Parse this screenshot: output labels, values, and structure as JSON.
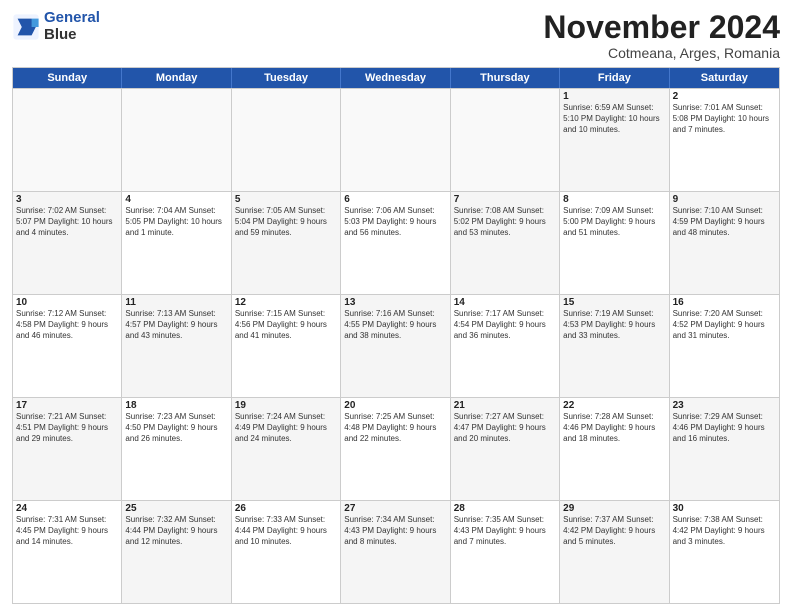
{
  "logo": {
    "line1": "General",
    "line2": "Blue"
  },
  "title": "November 2024",
  "subtitle": "Cotmeana, Arges, Romania",
  "days": [
    "Sunday",
    "Monday",
    "Tuesday",
    "Wednesday",
    "Thursday",
    "Friday",
    "Saturday"
  ],
  "rows": [
    [
      {
        "day": "",
        "text": "",
        "empty": true
      },
      {
        "day": "",
        "text": "",
        "empty": true
      },
      {
        "day": "",
        "text": "",
        "empty": true
      },
      {
        "day": "",
        "text": "",
        "empty": true
      },
      {
        "day": "",
        "text": "",
        "empty": true
      },
      {
        "day": "1",
        "text": "Sunrise: 6:59 AM\nSunset: 5:10 PM\nDaylight: 10 hours\nand 10 minutes.",
        "empty": false,
        "shaded": true
      },
      {
        "day": "2",
        "text": "Sunrise: 7:01 AM\nSunset: 5:08 PM\nDaylight: 10 hours\nand 7 minutes.",
        "empty": false,
        "shaded": false
      }
    ],
    [
      {
        "day": "3",
        "text": "Sunrise: 7:02 AM\nSunset: 5:07 PM\nDaylight: 10 hours\nand 4 minutes.",
        "empty": false,
        "shaded": true
      },
      {
        "day": "4",
        "text": "Sunrise: 7:04 AM\nSunset: 5:05 PM\nDaylight: 10 hours\nand 1 minute.",
        "empty": false,
        "shaded": false
      },
      {
        "day": "5",
        "text": "Sunrise: 7:05 AM\nSunset: 5:04 PM\nDaylight: 9 hours\nand 59 minutes.",
        "empty": false,
        "shaded": true
      },
      {
        "day": "6",
        "text": "Sunrise: 7:06 AM\nSunset: 5:03 PM\nDaylight: 9 hours\nand 56 minutes.",
        "empty": false,
        "shaded": false
      },
      {
        "day": "7",
        "text": "Sunrise: 7:08 AM\nSunset: 5:02 PM\nDaylight: 9 hours\nand 53 minutes.",
        "empty": false,
        "shaded": true
      },
      {
        "day": "8",
        "text": "Sunrise: 7:09 AM\nSunset: 5:00 PM\nDaylight: 9 hours\nand 51 minutes.",
        "empty": false,
        "shaded": false
      },
      {
        "day": "9",
        "text": "Sunrise: 7:10 AM\nSunset: 4:59 PM\nDaylight: 9 hours\nand 48 minutes.",
        "empty": false,
        "shaded": true
      }
    ],
    [
      {
        "day": "10",
        "text": "Sunrise: 7:12 AM\nSunset: 4:58 PM\nDaylight: 9 hours\nand 46 minutes.",
        "empty": false,
        "shaded": false
      },
      {
        "day": "11",
        "text": "Sunrise: 7:13 AM\nSunset: 4:57 PM\nDaylight: 9 hours\nand 43 minutes.",
        "empty": false,
        "shaded": true
      },
      {
        "day": "12",
        "text": "Sunrise: 7:15 AM\nSunset: 4:56 PM\nDaylight: 9 hours\nand 41 minutes.",
        "empty": false,
        "shaded": false
      },
      {
        "day": "13",
        "text": "Sunrise: 7:16 AM\nSunset: 4:55 PM\nDaylight: 9 hours\nand 38 minutes.",
        "empty": false,
        "shaded": true
      },
      {
        "day": "14",
        "text": "Sunrise: 7:17 AM\nSunset: 4:54 PM\nDaylight: 9 hours\nand 36 minutes.",
        "empty": false,
        "shaded": false
      },
      {
        "day": "15",
        "text": "Sunrise: 7:19 AM\nSunset: 4:53 PM\nDaylight: 9 hours\nand 33 minutes.",
        "empty": false,
        "shaded": true
      },
      {
        "day": "16",
        "text": "Sunrise: 7:20 AM\nSunset: 4:52 PM\nDaylight: 9 hours\nand 31 minutes.",
        "empty": false,
        "shaded": false
      }
    ],
    [
      {
        "day": "17",
        "text": "Sunrise: 7:21 AM\nSunset: 4:51 PM\nDaylight: 9 hours\nand 29 minutes.",
        "empty": false,
        "shaded": true
      },
      {
        "day": "18",
        "text": "Sunrise: 7:23 AM\nSunset: 4:50 PM\nDaylight: 9 hours\nand 26 minutes.",
        "empty": false,
        "shaded": false
      },
      {
        "day": "19",
        "text": "Sunrise: 7:24 AM\nSunset: 4:49 PM\nDaylight: 9 hours\nand 24 minutes.",
        "empty": false,
        "shaded": true
      },
      {
        "day": "20",
        "text": "Sunrise: 7:25 AM\nSunset: 4:48 PM\nDaylight: 9 hours\nand 22 minutes.",
        "empty": false,
        "shaded": false
      },
      {
        "day": "21",
        "text": "Sunrise: 7:27 AM\nSunset: 4:47 PM\nDaylight: 9 hours\nand 20 minutes.",
        "empty": false,
        "shaded": true
      },
      {
        "day": "22",
        "text": "Sunrise: 7:28 AM\nSunset: 4:46 PM\nDaylight: 9 hours\nand 18 minutes.",
        "empty": false,
        "shaded": false
      },
      {
        "day": "23",
        "text": "Sunrise: 7:29 AM\nSunset: 4:46 PM\nDaylight: 9 hours\nand 16 minutes.",
        "empty": false,
        "shaded": true
      }
    ],
    [
      {
        "day": "24",
        "text": "Sunrise: 7:31 AM\nSunset: 4:45 PM\nDaylight: 9 hours\nand 14 minutes.",
        "empty": false,
        "shaded": false
      },
      {
        "day": "25",
        "text": "Sunrise: 7:32 AM\nSunset: 4:44 PM\nDaylight: 9 hours\nand 12 minutes.",
        "empty": false,
        "shaded": true
      },
      {
        "day": "26",
        "text": "Sunrise: 7:33 AM\nSunset: 4:44 PM\nDaylight: 9 hours\nand 10 minutes.",
        "empty": false,
        "shaded": false
      },
      {
        "day": "27",
        "text": "Sunrise: 7:34 AM\nSunset: 4:43 PM\nDaylight: 9 hours\nand 8 minutes.",
        "empty": false,
        "shaded": true
      },
      {
        "day": "28",
        "text": "Sunrise: 7:35 AM\nSunset: 4:43 PM\nDaylight: 9 hours\nand 7 minutes.",
        "empty": false,
        "shaded": false
      },
      {
        "day": "29",
        "text": "Sunrise: 7:37 AM\nSunset: 4:42 PM\nDaylight: 9 hours\nand 5 minutes.",
        "empty": false,
        "shaded": true
      },
      {
        "day": "30",
        "text": "Sunrise: 7:38 AM\nSunset: 4:42 PM\nDaylight: 9 hours\nand 3 minutes.",
        "empty": false,
        "shaded": false
      }
    ]
  ]
}
